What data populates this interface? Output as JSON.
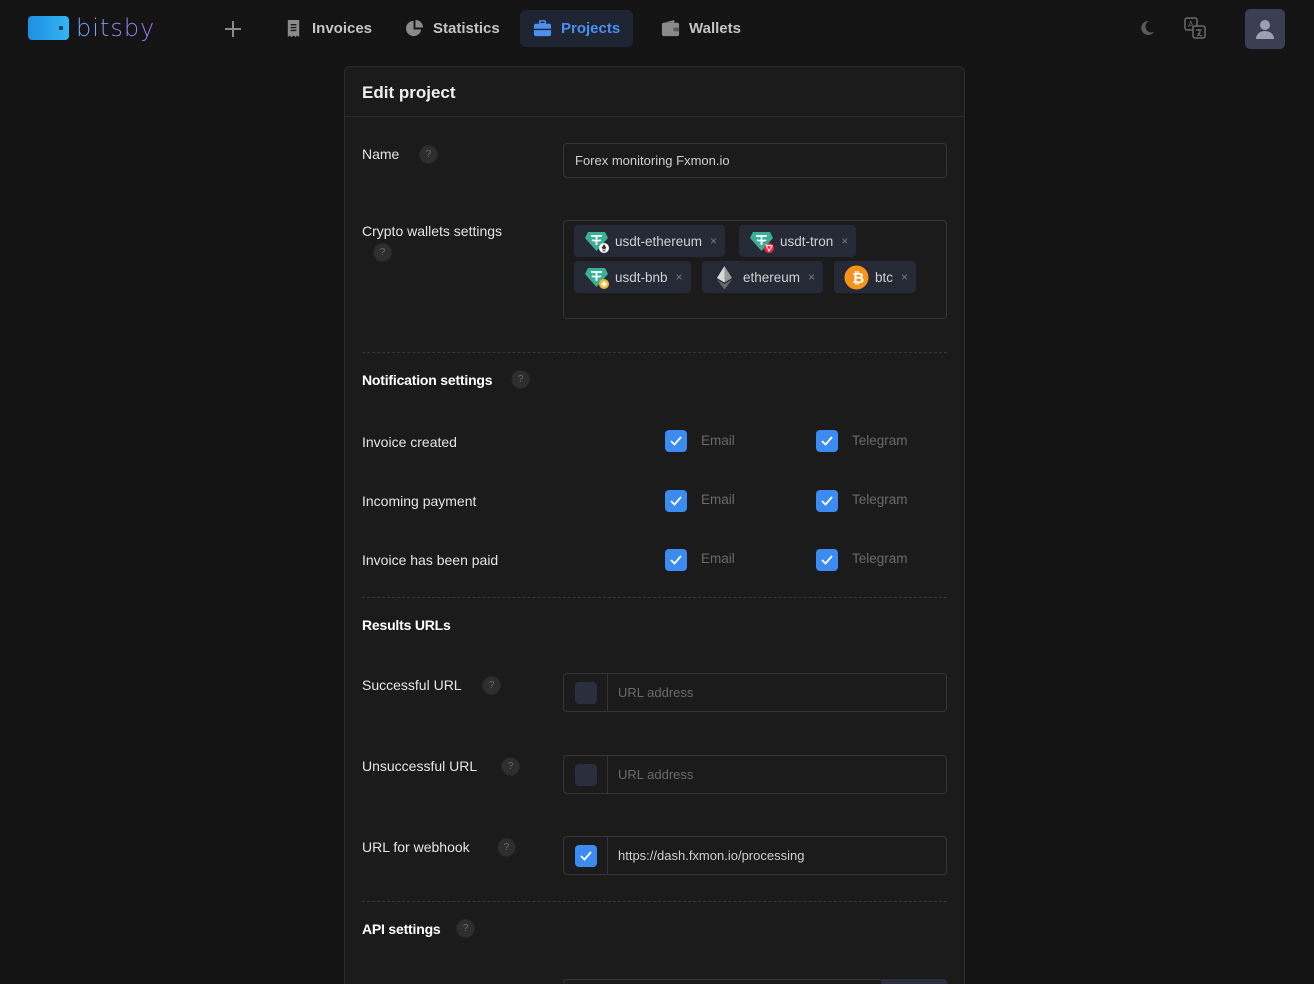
{
  "brand": {
    "name": "bitsby"
  },
  "nav": {
    "items": [
      {
        "label": "Invoices",
        "icon": "receipt-icon"
      },
      {
        "label": "Statistics",
        "icon": "pie-chart-icon"
      },
      {
        "label": "Projects",
        "icon": "briefcase-icon",
        "active": true
      },
      {
        "label": "Wallets",
        "icon": "wallet-icon"
      }
    ],
    "actions": [
      "plus-icon",
      "moon-icon",
      "translate-icon",
      "user-icon"
    ]
  },
  "form": {
    "title": "Edit project",
    "name": {
      "label": "Name",
      "value": "Forex monitoring Fxmon.io"
    },
    "wallets": {
      "label": "Crypto wallets settings",
      "chips": [
        {
          "label": "usdt-ethereum",
          "icon": "tether-ethereum-icon"
        },
        {
          "label": "usdt-tron",
          "icon": "tether-tron-icon"
        },
        {
          "label": "usdt-bnb",
          "icon": "tether-bnb-icon"
        },
        {
          "label": "ethereum",
          "icon": "ethereum-icon"
        },
        {
          "label": "btc",
          "icon": "bitcoin-icon"
        }
      ]
    },
    "notifications": {
      "title": "Notification settings",
      "channels": [
        "Email",
        "Telegram"
      ],
      "rows": [
        {
          "label": "Invoice created",
          "email": true,
          "telegram": true
        },
        {
          "label": "Incoming payment",
          "email": true,
          "telegram": true
        },
        {
          "label": "Invoice has been paid",
          "email": true,
          "telegram": true
        }
      ]
    },
    "results": {
      "title": "Results URLs",
      "rows": [
        {
          "label": "Successful URL",
          "checked": false,
          "value": "",
          "placeholder": "URL address"
        },
        {
          "label": "Unsuccessful URL",
          "checked": false,
          "value": "",
          "placeholder": "URL address"
        },
        {
          "label": "URL for webhook",
          "checked": true,
          "value": "https://dash.fxmon.io/processing",
          "placeholder": "URL address"
        }
      ]
    },
    "api": {
      "title": "API settings"
    },
    "help_glyph": "?",
    "chip_remove_glyph": "×"
  },
  "colors": {
    "accent": "#3b8bf0",
    "background": "#141414",
    "card": "#1b1b1b",
    "active_nav_bg": "#1f2433",
    "tether": "#3bb097"
  }
}
